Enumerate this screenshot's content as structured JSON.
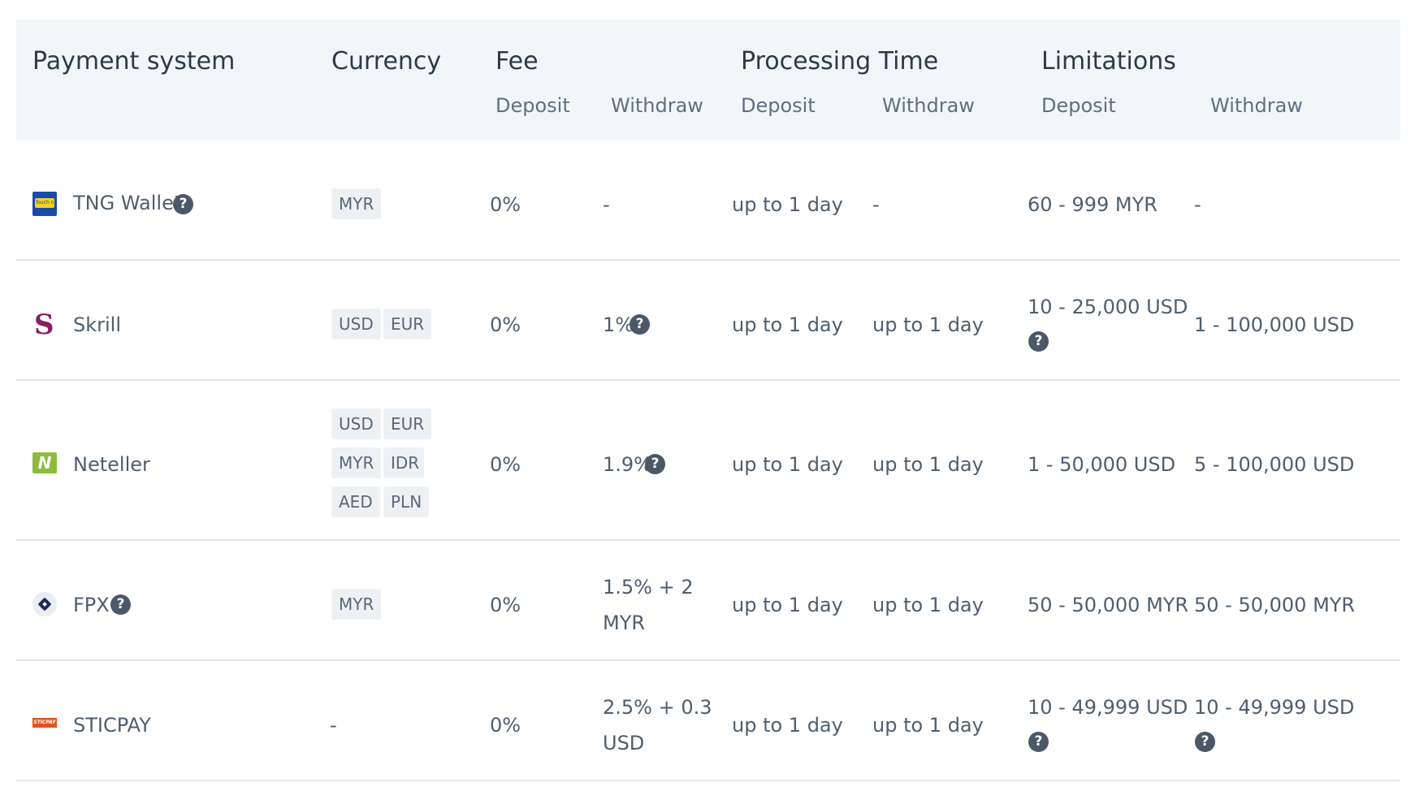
{
  "header": {
    "payment_system": "Payment system",
    "currency": "Currency",
    "fee": "Fee",
    "processing_time": "Processing Time",
    "limitations": "Limitations",
    "deposit": "Deposit",
    "withdraw": "Withdraw"
  },
  "rows": [
    {
      "name": "TNG Wallet",
      "logo_text": "Touch n Go",
      "currencies": [
        "MYR"
      ],
      "fee_deposit": "0%",
      "fee_withdraw": "-",
      "time_deposit": "up to 1 day",
      "time_withdraw": "-",
      "limit_deposit": "60 - 999 MYR",
      "limit_withdraw": "-"
    },
    {
      "name": "Skrill",
      "logo_text": "S",
      "currencies": [
        "USD",
        "EUR"
      ],
      "fee_deposit": "0%",
      "fee_withdraw": "1%",
      "time_deposit": "up to 1 day",
      "time_withdraw": "up to 1 day",
      "limit_deposit": "10 - 25,000 USD",
      "limit_withdraw": "1 - 100,000 USD"
    },
    {
      "name": "Neteller",
      "logo_text": "N",
      "currencies": [
        "USD",
        "EUR",
        "MYR",
        "IDR",
        "AED",
        "PLN"
      ],
      "fee_deposit": "0%",
      "fee_withdraw": "1.9%",
      "time_deposit": "up to 1 day",
      "time_withdraw": "up to 1 day",
      "limit_deposit": "1 - 50,000 USD",
      "limit_withdraw": "5 - 100,000 USD"
    },
    {
      "name": "FPX",
      "logo_text": "",
      "currencies": [
        "MYR"
      ],
      "fee_deposit": "0%",
      "fee_withdraw_line1": "1.5% + 2",
      "fee_withdraw_line2": "MYR",
      "time_deposit": "up to 1 day",
      "time_withdraw": "up to 1 day",
      "limit_deposit": "50 - 50,000 MYR",
      "limit_withdraw": "50 - 50,000 MYR"
    },
    {
      "name": "STICPAY",
      "logo_text": "STICPAY",
      "currency_text": "-",
      "fee_deposit": "0%",
      "fee_withdraw_line1": "2.5% + 0.3",
      "fee_withdraw_line2": "USD",
      "time_deposit": "up to 1 day",
      "time_withdraw": "up to 1 day",
      "limit_deposit": "10 - 49,999 USD",
      "limit_withdraw": "10 - 49,999 USD"
    }
  ],
  "help_glyph": "?",
  "colors": {
    "header_bg": "#f3f6f9",
    "text": "#4f5e6e",
    "tag_bg": "#eef1f4",
    "skrill": "#862165",
    "neteller": "#8dbb3e",
    "sticpay": "#e8531c",
    "tng": "#1a4aa8"
  }
}
